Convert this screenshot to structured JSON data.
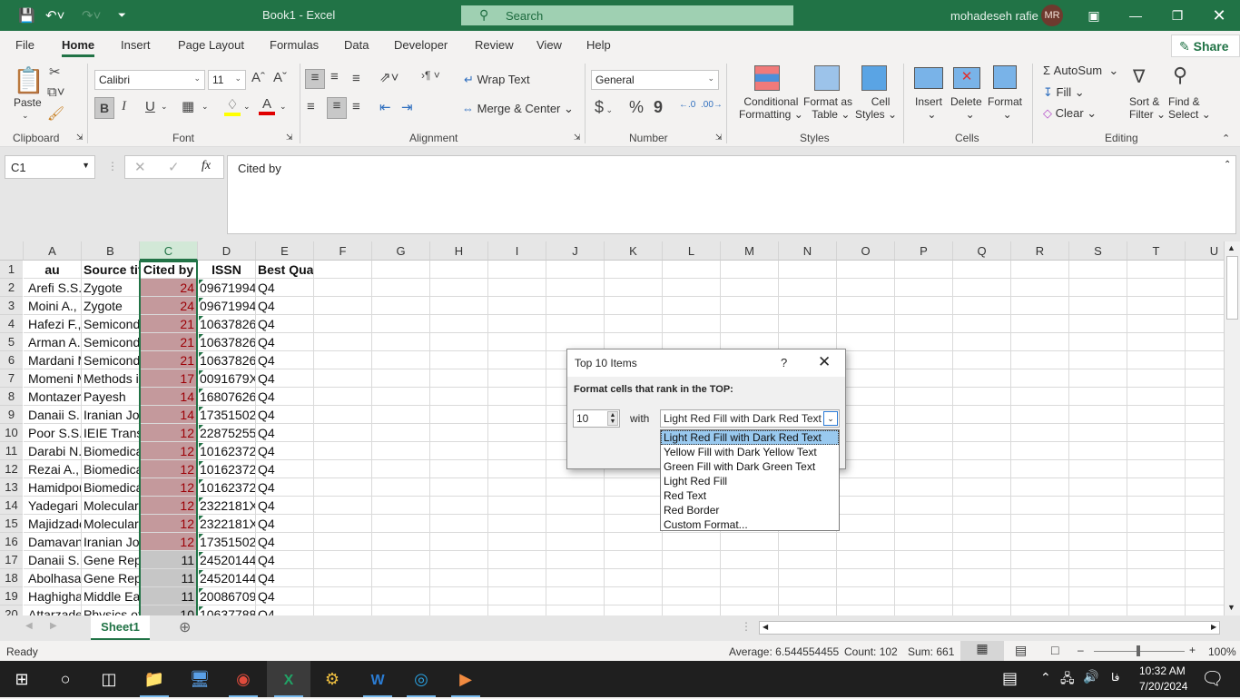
{
  "titlebar": {
    "title": "Book1  -  Excel",
    "search_placeholder": "Search",
    "user_name": "mohadeseh rafie",
    "user_initials": "MR"
  },
  "tabs": [
    "File",
    "Home",
    "Insert",
    "Page Layout",
    "Formulas",
    "Data",
    "Developer",
    "Review",
    "View",
    "Help"
  ],
  "active_tab": "Home",
  "share_label": "Share",
  "ribbon": {
    "clipboard": {
      "paste": "Paste",
      "label": "Clipboard"
    },
    "font": {
      "name": "Calibri",
      "size": "11",
      "label": "Font",
      "bold": "B",
      "italic": "I",
      "underline": "U"
    },
    "alignment": {
      "wrap_text": "Wrap Text",
      "merge_center": "Merge & Center",
      "label": "Alignment"
    },
    "number": {
      "format": "General",
      "currency": "$",
      "percent": "%",
      "comma": "9",
      "label": "Number"
    },
    "styles": {
      "conditional": "Conditional",
      "conditional2": "Formatting",
      "format_table": "Format as",
      "format_table2": "Table",
      "cell_styles": "Cell",
      "cell_styles2": "Styles",
      "label": "Styles"
    },
    "cells": {
      "insert": "Insert",
      "delete": "Delete",
      "format": "Format",
      "label": "Cells"
    },
    "editing": {
      "autosum": "AutoSum",
      "fill": "Fill",
      "clear": "Clear",
      "sort": "Sort &",
      "sort2": "Filter",
      "find": "Find &",
      "find2": "Select",
      "label": "Editing"
    }
  },
  "formula_bar": {
    "name_box": "C1",
    "fx": "fx",
    "content": "Cited by"
  },
  "columns": [
    "A",
    "B",
    "C",
    "D",
    "E",
    "F",
    "G",
    "H",
    "I",
    "J",
    "K",
    "L",
    "M",
    "N",
    "O",
    "P",
    "Q",
    "R",
    "S",
    "T",
    "U"
  ],
  "rows": [
    {
      "n": "1",
      "a": "au",
      "b": "Source title",
      "c": "Cited by",
      "d": "ISSN",
      "e": "Best Quartile"
    },
    {
      "n": "2",
      "a": "Arefi S.S.,",
      "b": "Zygote",
      "c": "24",
      "d": "09671994",
      "e": "Q4"
    },
    {
      "n": "3",
      "a": "Moini A.,",
      "b": "Zygote",
      "c": "24",
      "d": "09671994",
      "e": "Q4"
    },
    {
      "n": "4",
      "a": "Hafezi F.,",
      "b": "Semicond",
      "c": "21",
      "d": "10637826",
      "e": "Q4"
    },
    {
      "n": "5",
      "a": "Arman A.,",
      "b": "Semicond",
      "c": "21",
      "d": "10637826",
      "e": "Q4"
    },
    {
      "n": "6",
      "a": "Mardani M",
      "b": "Semicond",
      "c": "21",
      "d": "10637826",
      "e": "Q4"
    },
    {
      "n": "7",
      "a": "Momeni M",
      "b": "Methods i",
      "c": "17",
      "d": "0091679X",
      "e": "Q4"
    },
    {
      "n": "8",
      "a": "Montazer",
      "b": "Payesh",
      "c": "14",
      "d": "16807626",
      "e": "Q4"
    },
    {
      "n": "9",
      "a": "Danaii S.,",
      "b": "Iranian Jo",
      "c": "14",
      "d": "17351502",
      "e": "Q4"
    },
    {
      "n": "10",
      "a": "Poor S.S.A",
      "b": "IEIE Transa",
      "c": "12",
      "d": "22875255",
      "e": "Q4"
    },
    {
      "n": "11",
      "a": "Darabi N.,",
      "b": "Biomedica",
      "c": "12",
      "d": "10162372",
      "e": "Q4"
    },
    {
      "n": "12",
      "a": "Rezai A., A",
      "b": "Biomedica",
      "c": "12",
      "d": "10162372",
      "e": "Q4"
    },
    {
      "n": "13",
      "a": "Hamidpou",
      "b": "Biomedica",
      "c": "12",
      "d": "10162372",
      "e": "Q4"
    },
    {
      "n": "14",
      "a": "Yadegari F",
      "b": "Molecular",
      "c": "12",
      "d": "2322181X",
      "e": "Q4"
    },
    {
      "n": "15",
      "a": "Majidzade",
      "b": "Molecular",
      "c": "12",
      "d": "2322181X",
      "e": "Q4"
    },
    {
      "n": "16",
      "a": "Damavan",
      "b": "Iranian Jo",
      "c": "12",
      "d": "17351502",
      "e": "Q4"
    },
    {
      "n": "17",
      "a": "Danaii S., ",
      "b": "Gene Rep",
      "c": "11",
      "d": "24520144",
      "e": "Q4"
    },
    {
      "n": "18",
      "a": "Abolhasa",
      "b": "Gene Rep",
      "c": "11",
      "d": "24520144",
      "e": "Q4"
    },
    {
      "n": "19",
      "a": "Haghigha",
      "b": "Middle Ea",
      "c": "11",
      "d": "20086709",
      "e": "Q4"
    },
    {
      "n": "20",
      "a": "Attarzade",
      "b": "Physics of",
      "c": "10",
      "d": "10637788",
      "e": "Q4"
    }
  ],
  "highlight_top_rows": 15,
  "colors": {
    "excel_green": "#217346",
    "highlight_fill": "#c4999c",
    "highlight_text": "#9c0006"
  },
  "sheets": [
    "Sheet1"
  ],
  "status": {
    "ready": "Ready",
    "average": "Average: 6.544554455",
    "count": "Count: 102",
    "sum": "Sum: 661",
    "zoom": "100%"
  },
  "dialog": {
    "title": "Top 10 Items",
    "help": "?",
    "prompt": "Format cells that rank in the TOP:",
    "rank_value": "10",
    "with_label": "with",
    "selected_format": "Light Red Fill with Dark Red Text",
    "options": [
      "Light Red Fill with Dark Red Text",
      "Yellow Fill with Dark Yellow Text",
      "Green Fill with Dark Green Text",
      "Light Red Fill",
      "Red Text",
      "Red Border",
      "Custom Format..."
    ]
  },
  "taskbar": {
    "time": "10:32 AM",
    "date": "7/20/2024",
    "lang": "فا"
  }
}
